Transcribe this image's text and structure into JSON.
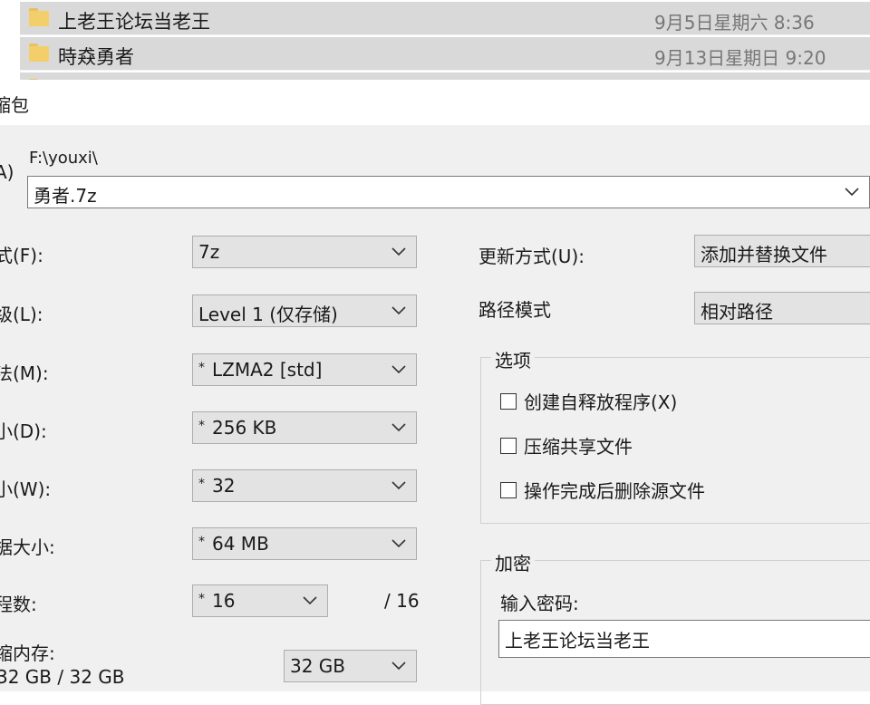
{
  "explorer": {
    "rows": [
      {
        "name": "上老王论坛当老王",
        "date": "9月5日星期六 8:36"
      },
      {
        "name": "時猋勇者",
        "date": "9月13日星期日 9:20"
      }
    ]
  },
  "dialog": {
    "title": "缩包",
    "archive": {
      "label": "A)",
      "path": "F:\\youxi\\",
      "value": "勇者.7z"
    },
    "left_fields": [
      {
        "label": "式(F):",
        "value": "7z",
        "star": ""
      },
      {
        "label": "级(L):",
        "value": "Level 1 (仅存储)",
        "star": ""
      },
      {
        "label": "法(M):",
        "value": "LZMA2 [std]",
        "star": "*"
      },
      {
        "label": "小(D):",
        "value": "256 KB",
        "star": "*"
      },
      {
        "label": "小(W):",
        "value": "32",
        "star": "*"
      },
      {
        "label": "据大小:",
        "value": "64 MB",
        "star": "*"
      }
    ],
    "threads": {
      "label": "程数:",
      "value": "16",
      "star": "*",
      "max": "/ 16"
    },
    "memory": {
      "label": "缩内存:",
      "sub": "32 GB / 32 GB",
      "value": "32 GB"
    },
    "update_mode": {
      "label": "更新方式(U):",
      "value": "添加并替换文件"
    },
    "path_mode": {
      "label": "路径模式",
      "value": "相对路径"
    },
    "options": {
      "title": "选项",
      "items": [
        {
          "label": "创建自释放程序(X)",
          "checked": false
        },
        {
          "label": "压缩共享文件",
          "checked": false
        },
        {
          "label": "操作完成后删除源文件",
          "checked": false
        }
      ]
    },
    "encryption": {
      "title": "加密",
      "password_label": "输入密码:",
      "password_value": "上老王论坛当老王"
    }
  }
}
